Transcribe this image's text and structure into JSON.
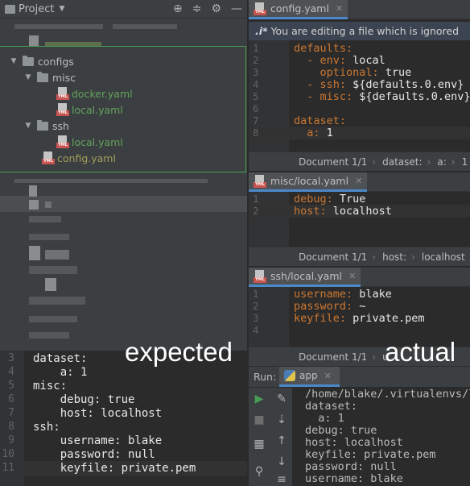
{
  "project": {
    "title": "Project",
    "tree": [
      {
        "label": "configs",
        "kind": "folder"
      },
      {
        "label": "misc",
        "kind": "folder"
      },
      {
        "label": "docker.yaml",
        "kind": "yaml"
      },
      {
        "label": "local.yaml",
        "kind": "yaml"
      },
      {
        "label": "ssh",
        "kind": "folder"
      },
      {
        "label": "local.yaml",
        "kind": "yaml"
      },
      {
        "label": "config.yaml",
        "kind": "yaml"
      }
    ]
  },
  "expected": {
    "tag": "expected",
    "lines": [
      {
        "n": "3",
        "t": "dataset:"
      },
      {
        "n": "4",
        "t": "    a: 1"
      },
      {
        "n": "5",
        "t": "misc:"
      },
      {
        "n": "6",
        "t": "    debug: true"
      },
      {
        "n": "7",
        "t": "    host: localhost"
      },
      {
        "n": "8",
        "t": "ssh:"
      },
      {
        "n": "9",
        "t": "    username: blake"
      },
      {
        "n": "10",
        "t": "    password: null"
      },
      {
        "n": "11",
        "t": "    keyfile: private.pem"
      }
    ]
  },
  "actual_tag": "actual",
  "editor1": {
    "tab": "config.yaml",
    "banner": "You are editing a file which is ignored",
    "banner_icon": ".i*",
    "lines": [
      {
        "n": "1",
        "k": "defaults:",
        "v": ""
      },
      {
        "n": "2",
        "k": "  - env:",
        "v": " local"
      },
      {
        "n": "3",
        "k": "    optional:",
        "v": " true"
      },
      {
        "n": "4",
        "k": "  - ssh:",
        "v": " ${defaults.0.env}"
      },
      {
        "n": "5",
        "k": "  - misc:",
        "v": " ${defaults.0.env}"
      },
      {
        "n": "6",
        "k": "",
        "v": ""
      },
      {
        "n": "7",
        "k": "dataset:",
        "v": ""
      },
      {
        "n": "8",
        "k": "  a:",
        "v": " 1"
      }
    ],
    "breadcrumb": [
      "Document 1/1",
      "dataset:",
      "a:",
      "1"
    ]
  },
  "editor2": {
    "tab": "misc/local.yaml",
    "lines": [
      {
        "n": "1",
        "k": "debug:",
        "v": " True"
      },
      {
        "n": "2",
        "k": "host:",
        "v": " localhost"
      }
    ],
    "breadcrumb": [
      "Document 1/1",
      "host:",
      "localhost"
    ]
  },
  "editor3": {
    "tab": "ssh/local.yaml",
    "lines": [
      {
        "n": "1",
        "k": "username:",
        "v": " blake"
      },
      {
        "n": "2",
        "k": "password:",
        "v": " ~"
      },
      {
        "n": "3",
        "k": "keyfile:",
        "v": " private.pem"
      },
      {
        "n": "4",
        "k": "",
        "v": ""
      }
    ],
    "breadcrumb": [
      "Document 1/1",
      "u"
    ]
  },
  "run": {
    "label": "Run:",
    "tab": "app",
    "output": [
      "/home/blake/.virtualenvs/l",
      "dataset:",
      "  a: 1",
      "debug: true",
      "host: localhost",
      "keyfile: private.pem",
      "password: null",
      "username: blake"
    ]
  },
  "colors": {
    "accent": "#4a88c7",
    "highlight_box": "#499c54",
    "yaml_key": "#cc7832"
  }
}
